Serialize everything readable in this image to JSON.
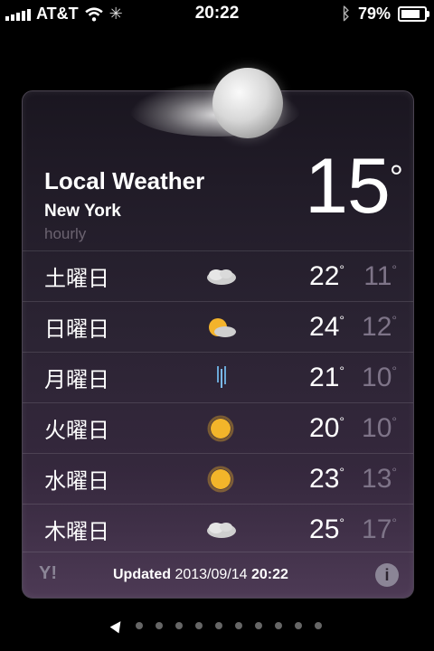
{
  "status": {
    "carrier": "AT&T",
    "time": "20:22",
    "battery_percent": "79%",
    "battery_fill": 0.79
  },
  "widget": {
    "title": "Local Weather",
    "city": "New York",
    "mode": "hourly",
    "current_temp": "15",
    "degree": "°",
    "forecast": [
      {
        "day": "土曜日",
        "icon": "cloud-icon",
        "high": "22",
        "low": "11"
      },
      {
        "day": "日曜日",
        "icon": "partly-sunny-icon",
        "high": "24",
        "low": "12"
      },
      {
        "day": "月曜日",
        "icon": "rain-icon",
        "high": "21",
        "low": "10"
      },
      {
        "day": "火曜日",
        "icon": "sun-icon",
        "high": "20",
        "low": "10"
      },
      {
        "day": "水曜日",
        "icon": "sun-icon",
        "high": "23",
        "low": "13"
      },
      {
        "day": "木曜日",
        "icon": "cloud-icon",
        "high": "25",
        "low": "17"
      }
    ],
    "footer": {
      "provider": "Y!",
      "updated_label": "Updated",
      "updated_date": "2013/09/14",
      "updated_time": "20:22",
      "info_label": "i"
    }
  },
  "page_dots": 10
}
